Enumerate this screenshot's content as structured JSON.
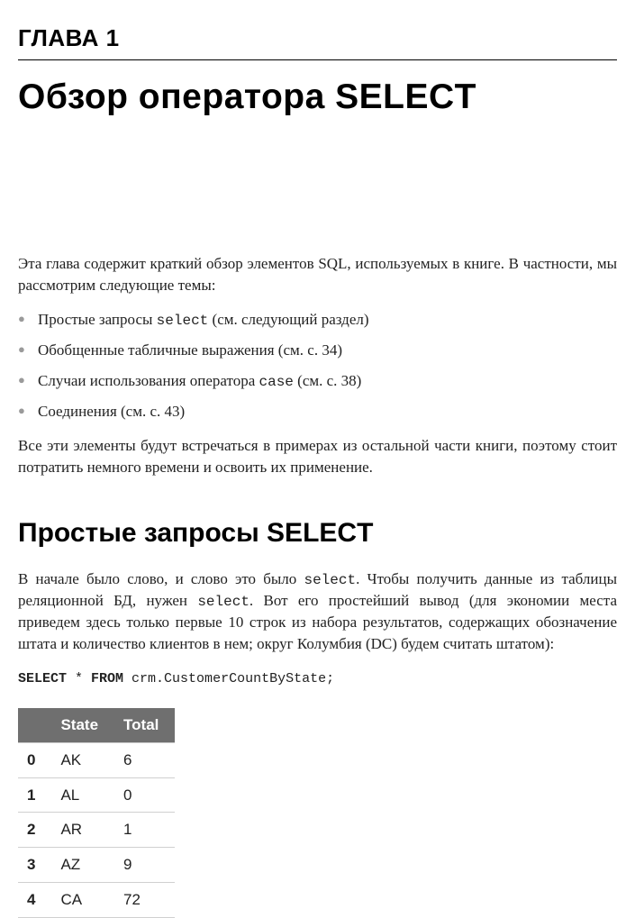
{
  "chapter_label": "ГЛАВА 1",
  "chapter_title": "Обзор оператора SELECT",
  "intro": "Эта глава содержит краткий обзор элементов SQL, используемых в книге. В частности, мы рассмотрим следующие темы:",
  "bullets": [
    {
      "pre": "Простые запросы ",
      "code": "select",
      "post": " (см. следующий раздел)"
    },
    {
      "pre": "Обобщенные табличные выражения (см. с. 34)",
      "code": "",
      "post": ""
    },
    {
      "pre": "Случаи использования оператора ",
      "code": "case",
      "post": " (см. с. 38)"
    },
    {
      "pre": "Соединения (см. с. 43)",
      "code": "",
      "post": ""
    }
  ],
  "post_intro": "Все эти элементы будут встречаться в примерах из остальной части книги, поэтому стоит потратить немного времени и освоить их применение.",
  "section_title": "Простые запросы SELECT",
  "section_para": {
    "p1": "В начале было слово, и слово это было ",
    "c1": "select",
    "p2": ". Чтобы получить данные из таблицы реляционной БД, нужен ",
    "c2": "select",
    "p3": ". Вот его простейший вывод (для экономии места приведем здесь только первые 10 строк из набора результатов, содержащих обозначение штата и количество клиентов в нем; округ Колумбия (DC) будем считать штатом):"
  },
  "code": {
    "kw1": "SELECT",
    "t1": " * ",
    "kw2": "FROM",
    "t2": " crm.CustomerCountByState;"
  },
  "table": {
    "headers": [
      "",
      "State",
      "Total"
    ],
    "rows": [
      {
        "idx": "0",
        "state": "AK",
        "total": "6"
      },
      {
        "idx": "1",
        "state": "AL",
        "total": "0"
      },
      {
        "idx": "2",
        "state": "AR",
        "total": "1"
      },
      {
        "idx": "3",
        "state": "AZ",
        "total": "9"
      },
      {
        "idx": "4",
        "state": "CA",
        "total": "72"
      }
    ]
  }
}
